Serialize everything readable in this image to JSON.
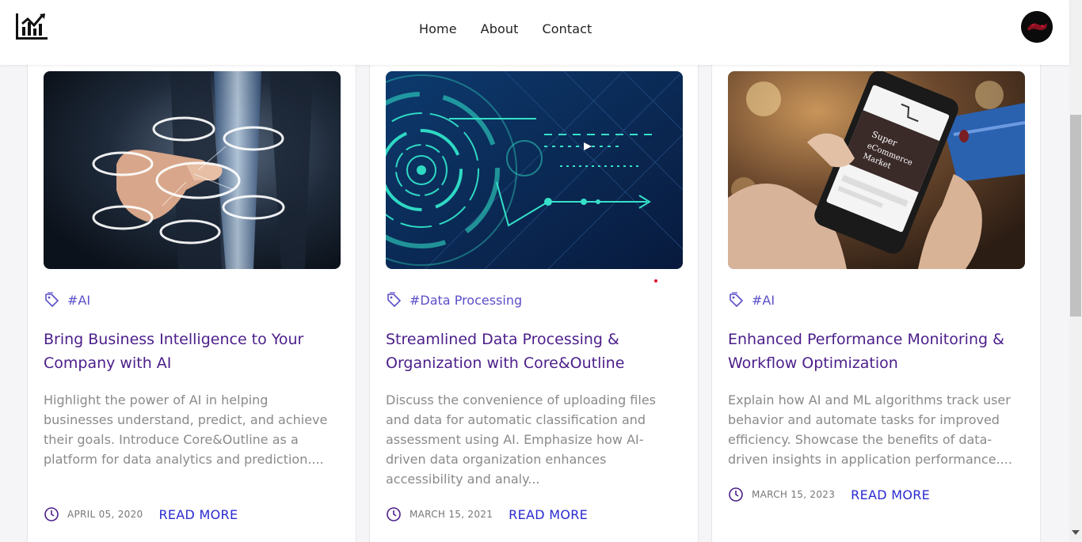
{
  "nav": {
    "logo_icon": "bar-chart-logo-icon",
    "links": [
      "Home",
      "About",
      "Contact"
    ],
    "avatar_icon": "user-avatar"
  },
  "cards": [
    {
      "image": "hand-touching-digital-rings-photo",
      "tag": "#AI",
      "title": "Bring Business Intelligence to Your Company with AI",
      "description": "Highlight the power of AI in helping businesses understand, predict, and achieve their goals. Introduce Core&Outline as a platform for data analytics and prediction....",
      "date": "APRIL 05, 2020",
      "read_more": "READ MORE"
    },
    {
      "image": "digital-circuit-arrow-illustration",
      "tag": "#Data Processing",
      "title": "Streamlined Data Processing & Organization with Core&Outline",
      "description": "Discuss the convenience of uploading files and data for automatic classification and assessment using AI. Emphasize how AI-driven data organization enhances accessibility and analy...",
      "date": "MARCH 15, 2021",
      "read_more": "READ MORE"
    },
    {
      "image": "phone-ecommerce-shopping-photo",
      "tag": "#AI",
      "title": "Enhanced Performance Monitoring & Workflow Optimization",
      "description": "Explain how AI and ML algorithms track user behavior and automate tasks for improved efficiency. Showcase the benefits of data-driven insights in application performance....",
      "date": "MARCH 15, 2023",
      "read_more": "READ MORE"
    }
  ],
  "colors": {
    "title": "#4b1e8a",
    "tag": "#5b4fc9",
    "read_more": "#2a2ad0",
    "body_text": "#8a8a8a"
  }
}
